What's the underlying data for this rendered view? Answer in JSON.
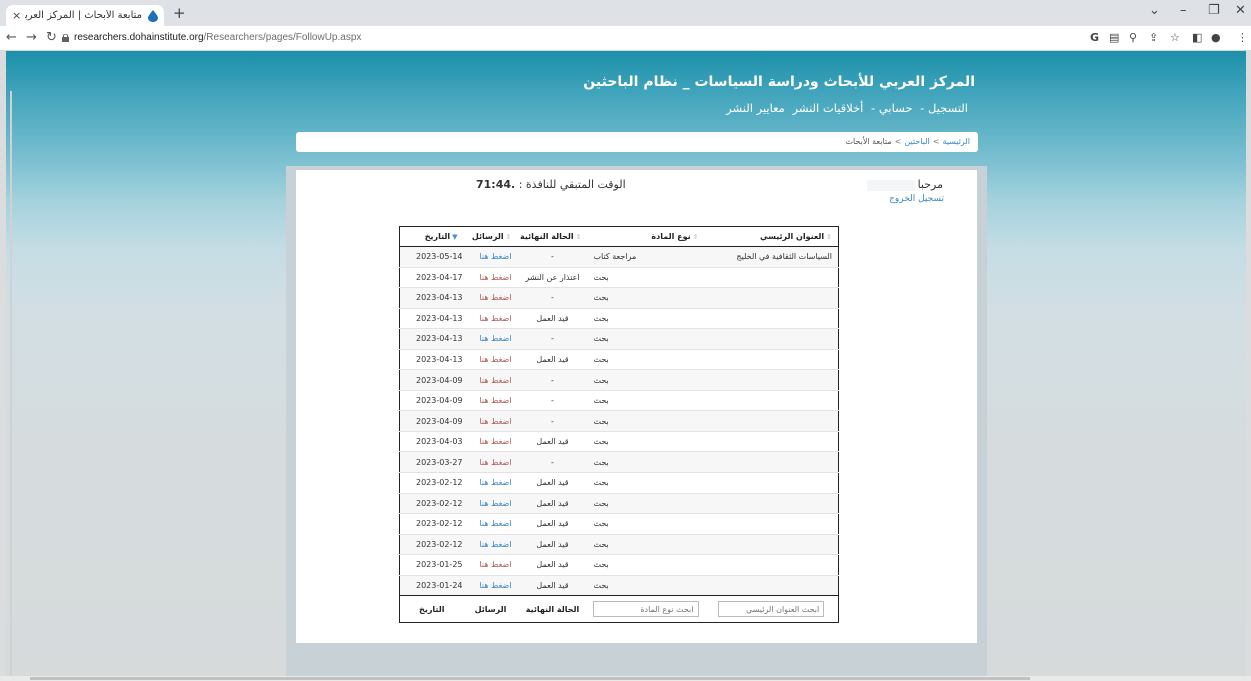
{
  "browser": {
    "tab_title": "متابعة الأبحاث | المركز العربي للأبحاث",
    "tab_close": "×",
    "new_tab": "+",
    "url_host": "researchers.dohainstitute.org",
    "url_path": "/Researchers/pages/FollowUp.aspx",
    "icons": [
      "google-icon",
      "translate-icon",
      "zoom-icon",
      "share-icon",
      "star-icon",
      "sidepanel-icon",
      "profile-icon",
      "menu-icon"
    ]
  },
  "header": {
    "title": "المركز العربي للأبحاث ودراسة السياسات _ نظام الباحثين",
    "menu": [
      "التسجيل -",
      "حسابي -",
      "أخلاقيات النشر",
      "معايير النشر"
    ]
  },
  "breadcrumb": [
    "الرئيسية",
    "الباحثين",
    "متابعة الأبحاث"
  ],
  "session": {
    "timer_label": "الوقت المتبقي للنافذة :",
    "timer_value": "71:44.",
    "welcome": "مرحبا",
    "logout": "تسجيل الخروج"
  },
  "table": {
    "headers": {
      "title": "العنوان الرئيسي",
      "type": "نوع المادة",
      "status": "الحالة النهائية",
      "messages": "الرسائل",
      "date": "التاريخ"
    },
    "rows": [
      {
        "title": "السياسات الثقافية في الخليج",
        "type": "مراجعة كتاب",
        "status": "-",
        "msg": "اضغط هنا",
        "msg_color": "blue",
        "date": "2023-05-14"
      },
      {
        "title": "",
        "type": "بحث",
        "status": "اعتذار عن النشر",
        "msg": "اضغط هنا",
        "msg_color": "red",
        "date": "2023-04-17"
      },
      {
        "title": "",
        "type": "بحث",
        "status": "-",
        "msg": "اضغط هنا",
        "msg_color": "red",
        "date": "2023-04-13"
      },
      {
        "title": "",
        "type": "بحث",
        "status": "قيد العمل",
        "msg": "اضغط هنا",
        "msg_color": "red",
        "date": "2023-04-13"
      },
      {
        "title": "",
        "type": "بحث",
        "status": "-",
        "msg": "اضغط هنا",
        "msg_color": "blue",
        "date": "2023-04-13"
      },
      {
        "title": "",
        "type": "بحث",
        "status": "قيد العمل",
        "msg": "اضغط هنا",
        "msg_color": "red",
        "date": "2023-04-13"
      },
      {
        "title": "",
        "type": "بحث",
        "status": "-",
        "msg": "اضغط هنا",
        "msg_color": "red",
        "date": "2023-04-09"
      },
      {
        "title": "",
        "type": "بحث",
        "status": "-",
        "msg": "اضغط هنا",
        "msg_color": "red",
        "date": "2023-04-09"
      },
      {
        "title": "",
        "type": "بحث",
        "status": "-",
        "msg": "اضغط هنا",
        "msg_color": "red",
        "date": "2023-04-09"
      },
      {
        "title": "",
        "type": "بحث",
        "status": "قيد العمل",
        "msg": "اضغط هنا",
        "msg_color": "red",
        "date": "2023-04-03"
      },
      {
        "title": "",
        "type": "بحث",
        "status": "-",
        "msg": "اضغط هنا",
        "msg_color": "red",
        "date": "2023-03-27"
      },
      {
        "title": "",
        "type": "بحث",
        "status": "قيد العمل",
        "msg": "اضغط هنا",
        "msg_color": "blue",
        "date": "2023-02-12"
      },
      {
        "title": "",
        "type": "بحث",
        "status": "قيد العمل",
        "msg": "اضغط هنا",
        "msg_color": "blue",
        "date": "2023-02-12"
      },
      {
        "title": "",
        "type": "بحث",
        "status": "قيد العمل",
        "msg": "اضغط هنا",
        "msg_color": "blue",
        "date": "2023-02-12"
      },
      {
        "title": "",
        "type": "بحث",
        "status": "قيد العمل",
        "msg": "اضغط هنا",
        "msg_color": "blue",
        "date": "2023-02-12"
      },
      {
        "title": "",
        "type": "بحث",
        "status": "قيد العمل",
        "msg": "اضغط هنا",
        "msg_color": "red",
        "date": "2023-01-25"
      },
      {
        "title": "",
        "type": "بحث",
        "status": "قيد العمل",
        "msg": "اضغط هنا",
        "msg_color": "blue",
        "date": "2023-01-24"
      }
    ],
    "footer": {
      "title_placeholder": "ابحث العنوان الرئيسي",
      "type_placeholder": "ابحث نوع المادة",
      "status": "الحالة النهائية",
      "messages": "الرسائل",
      "date": "التاريخ"
    }
  },
  "colors": {
    "link_blue": "#3a86c8",
    "link_red": "#b25a5a",
    "header_teal": "#1c8fa9"
  }
}
